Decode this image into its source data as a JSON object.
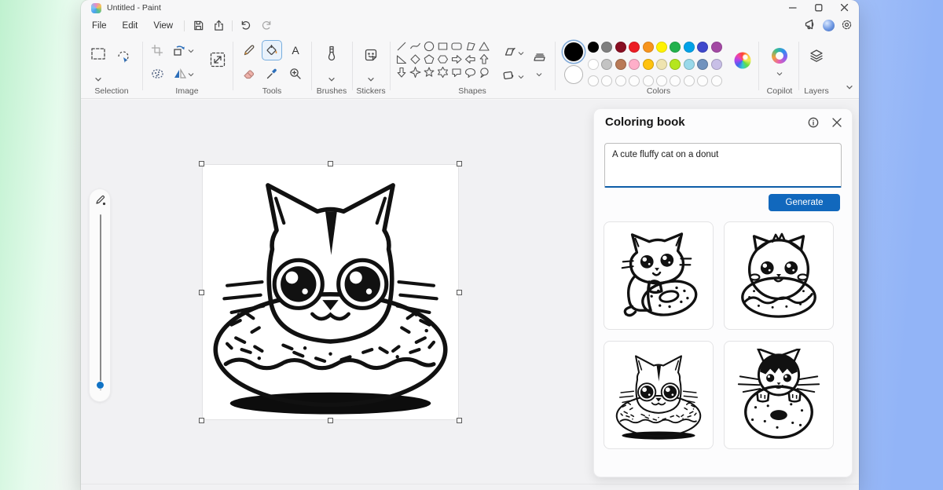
{
  "window": {
    "title": "Untitled - Paint"
  },
  "menu": {
    "items": [
      "File",
      "Edit",
      "View"
    ]
  },
  "ribbon": {
    "sections": {
      "selection": "Selection",
      "image": "Image",
      "tools": "Tools",
      "brushes": "Brushes",
      "stickers": "Stickers",
      "shapes": "Shapes",
      "colors": "Colors",
      "copilot": "Copilot",
      "layers": "Layers"
    }
  },
  "icons": {
    "text_tool_glyph": "A"
  },
  "colors": {
    "accent": "#1168bd",
    "selected_primary": "#000000",
    "secondary": "#ffffff",
    "row1": [
      "#000000",
      "#7f7f7f",
      "#880e22",
      "#ec1c24",
      "#f7941d",
      "#fff200",
      "#22b14c",
      "#00a2e8",
      "#3f48cc",
      "#a349a4"
    ],
    "row2": [
      "#ffffff",
      "#c3c3c3",
      "#b97a57",
      "#ffaec9",
      "#ffc20e",
      "#efe4b0",
      "#b5e61d",
      "#99d9ea",
      "#7092be",
      "#c8bfe7"
    ],
    "row3_empty_count": 10
  },
  "panel": {
    "title": "Coloring book",
    "prompt": "A cute fluffy cat on a donut",
    "generate_label": "Generate",
    "thumbnails": [
      "cat-hugging-donut",
      "fluffy-cat-on-donut",
      "cat-head-in-donut",
      "black-cat-behind-donut"
    ]
  }
}
